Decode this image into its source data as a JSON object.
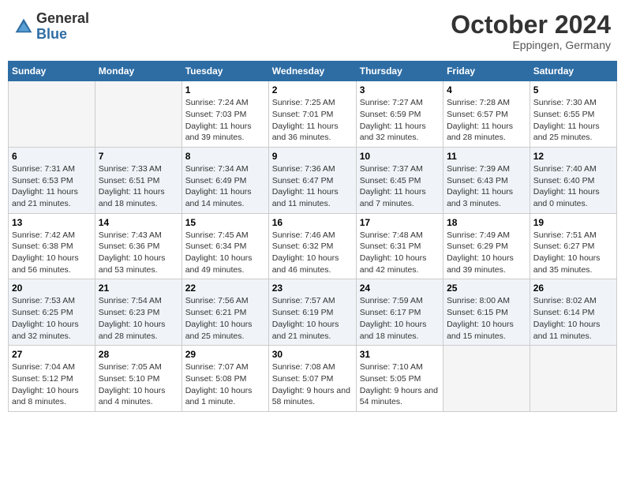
{
  "header": {
    "logo_general": "General",
    "logo_blue": "Blue",
    "month_title": "October 2024",
    "subtitle": "Eppingen, Germany"
  },
  "weekdays": [
    "Sunday",
    "Monday",
    "Tuesday",
    "Wednesday",
    "Thursday",
    "Friday",
    "Saturday"
  ],
  "weeks": [
    [
      {
        "day": "",
        "detail": ""
      },
      {
        "day": "",
        "detail": ""
      },
      {
        "day": "1",
        "detail": "Sunrise: 7:24 AM\nSunset: 7:03 PM\nDaylight: 11 hours and 39 minutes."
      },
      {
        "day": "2",
        "detail": "Sunrise: 7:25 AM\nSunset: 7:01 PM\nDaylight: 11 hours and 36 minutes."
      },
      {
        "day": "3",
        "detail": "Sunrise: 7:27 AM\nSunset: 6:59 PM\nDaylight: 11 hours and 32 minutes."
      },
      {
        "day": "4",
        "detail": "Sunrise: 7:28 AM\nSunset: 6:57 PM\nDaylight: 11 hours and 28 minutes."
      },
      {
        "day": "5",
        "detail": "Sunrise: 7:30 AM\nSunset: 6:55 PM\nDaylight: 11 hours and 25 minutes."
      }
    ],
    [
      {
        "day": "6",
        "detail": "Sunrise: 7:31 AM\nSunset: 6:53 PM\nDaylight: 11 hours and 21 minutes."
      },
      {
        "day": "7",
        "detail": "Sunrise: 7:33 AM\nSunset: 6:51 PM\nDaylight: 11 hours and 18 minutes."
      },
      {
        "day": "8",
        "detail": "Sunrise: 7:34 AM\nSunset: 6:49 PM\nDaylight: 11 hours and 14 minutes."
      },
      {
        "day": "9",
        "detail": "Sunrise: 7:36 AM\nSunset: 6:47 PM\nDaylight: 11 hours and 11 minutes."
      },
      {
        "day": "10",
        "detail": "Sunrise: 7:37 AM\nSunset: 6:45 PM\nDaylight: 11 hours and 7 minutes."
      },
      {
        "day": "11",
        "detail": "Sunrise: 7:39 AM\nSunset: 6:43 PM\nDaylight: 11 hours and 3 minutes."
      },
      {
        "day": "12",
        "detail": "Sunrise: 7:40 AM\nSunset: 6:40 PM\nDaylight: 11 hours and 0 minutes."
      }
    ],
    [
      {
        "day": "13",
        "detail": "Sunrise: 7:42 AM\nSunset: 6:38 PM\nDaylight: 10 hours and 56 minutes."
      },
      {
        "day": "14",
        "detail": "Sunrise: 7:43 AM\nSunset: 6:36 PM\nDaylight: 10 hours and 53 minutes."
      },
      {
        "day": "15",
        "detail": "Sunrise: 7:45 AM\nSunset: 6:34 PM\nDaylight: 10 hours and 49 minutes."
      },
      {
        "day": "16",
        "detail": "Sunrise: 7:46 AM\nSunset: 6:32 PM\nDaylight: 10 hours and 46 minutes."
      },
      {
        "day": "17",
        "detail": "Sunrise: 7:48 AM\nSunset: 6:31 PM\nDaylight: 10 hours and 42 minutes."
      },
      {
        "day": "18",
        "detail": "Sunrise: 7:49 AM\nSunset: 6:29 PM\nDaylight: 10 hours and 39 minutes."
      },
      {
        "day": "19",
        "detail": "Sunrise: 7:51 AM\nSunset: 6:27 PM\nDaylight: 10 hours and 35 minutes."
      }
    ],
    [
      {
        "day": "20",
        "detail": "Sunrise: 7:53 AM\nSunset: 6:25 PM\nDaylight: 10 hours and 32 minutes."
      },
      {
        "day": "21",
        "detail": "Sunrise: 7:54 AM\nSunset: 6:23 PM\nDaylight: 10 hours and 28 minutes."
      },
      {
        "day": "22",
        "detail": "Sunrise: 7:56 AM\nSunset: 6:21 PM\nDaylight: 10 hours and 25 minutes."
      },
      {
        "day": "23",
        "detail": "Sunrise: 7:57 AM\nSunset: 6:19 PM\nDaylight: 10 hours and 21 minutes."
      },
      {
        "day": "24",
        "detail": "Sunrise: 7:59 AM\nSunset: 6:17 PM\nDaylight: 10 hours and 18 minutes."
      },
      {
        "day": "25",
        "detail": "Sunrise: 8:00 AM\nSunset: 6:15 PM\nDaylight: 10 hours and 15 minutes."
      },
      {
        "day": "26",
        "detail": "Sunrise: 8:02 AM\nSunset: 6:14 PM\nDaylight: 10 hours and 11 minutes."
      }
    ],
    [
      {
        "day": "27",
        "detail": "Sunrise: 7:04 AM\nSunset: 5:12 PM\nDaylight: 10 hours and 8 minutes."
      },
      {
        "day": "28",
        "detail": "Sunrise: 7:05 AM\nSunset: 5:10 PM\nDaylight: 10 hours and 4 minutes."
      },
      {
        "day": "29",
        "detail": "Sunrise: 7:07 AM\nSunset: 5:08 PM\nDaylight: 10 hours and 1 minute."
      },
      {
        "day": "30",
        "detail": "Sunrise: 7:08 AM\nSunset: 5:07 PM\nDaylight: 9 hours and 58 minutes."
      },
      {
        "day": "31",
        "detail": "Sunrise: 7:10 AM\nSunset: 5:05 PM\nDaylight: 9 hours and 54 minutes."
      },
      {
        "day": "",
        "detail": ""
      },
      {
        "day": "",
        "detail": ""
      }
    ]
  ]
}
